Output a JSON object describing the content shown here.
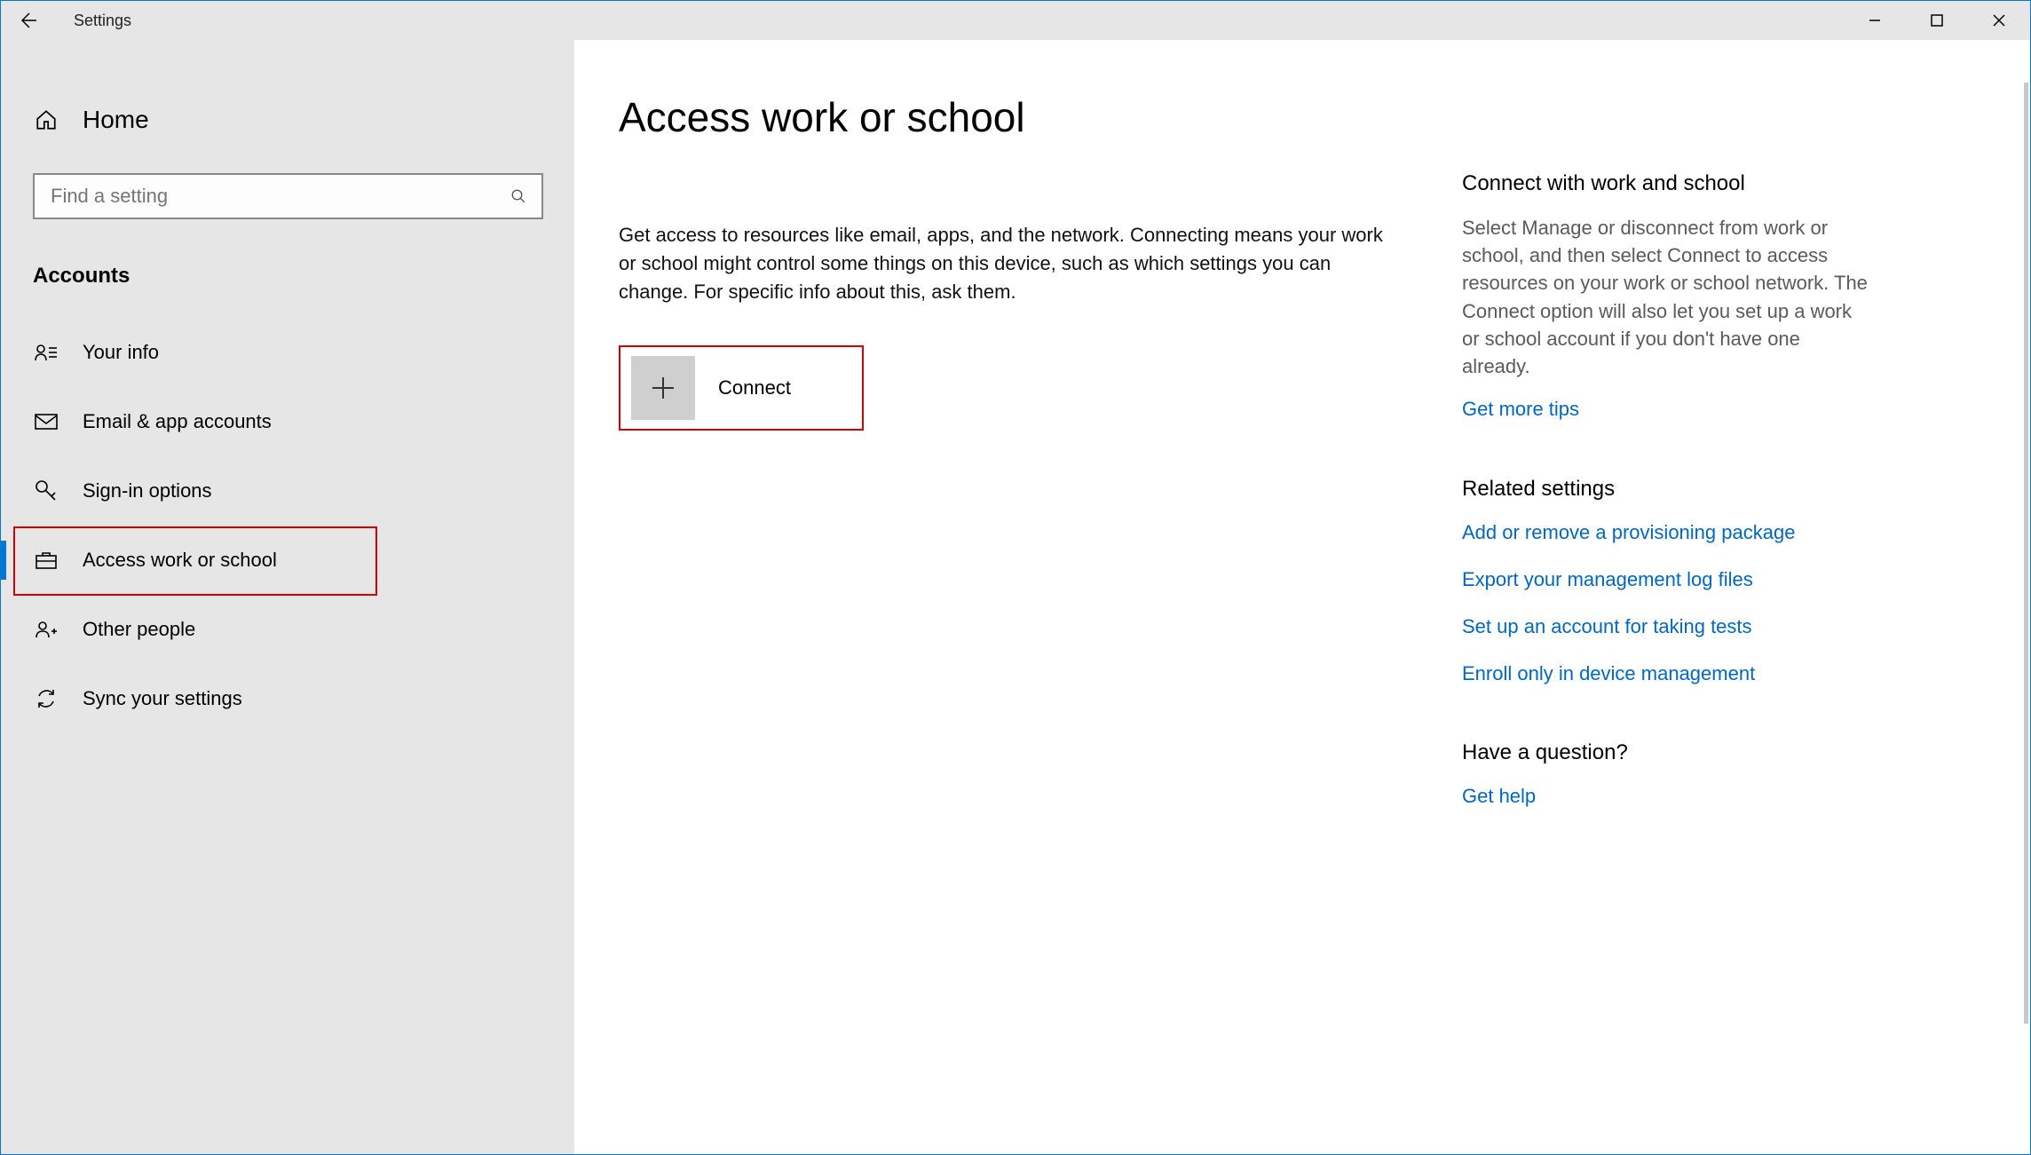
{
  "titlebar": {
    "title": "Settings"
  },
  "sidebar": {
    "home": "Home",
    "search_placeholder": "Find a setting",
    "section": "Accounts",
    "items": [
      {
        "label": "Your info"
      },
      {
        "label": "Email & app accounts"
      },
      {
        "label": "Sign-in options"
      },
      {
        "label": "Access work or school"
      },
      {
        "label": "Other people"
      },
      {
        "label": "Sync your settings"
      }
    ]
  },
  "main": {
    "title": "Access work or school",
    "description": "Get access to resources like email, apps, and the network. Connecting means your work or school might control some things on this device, such as which settings you can change. For specific info about this, ask them.",
    "connect_label": "Connect"
  },
  "right": {
    "connect": {
      "heading": "Connect with work and school",
      "text": "Select Manage or disconnect from work or school, and then select Connect to access resources on your work or school network. The Connect option will also let you set up a work or school account if you don't have one already.",
      "link": "Get more tips"
    },
    "related": {
      "heading": "Related settings",
      "links": [
        "Add or remove a provisioning package",
        "Export your management log files",
        "Set up an account for taking tests",
        "Enroll only in device management"
      ]
    },
    "question": {
      "heading": "Have a question?",
      "link": "Get help"
    }
  }
}
